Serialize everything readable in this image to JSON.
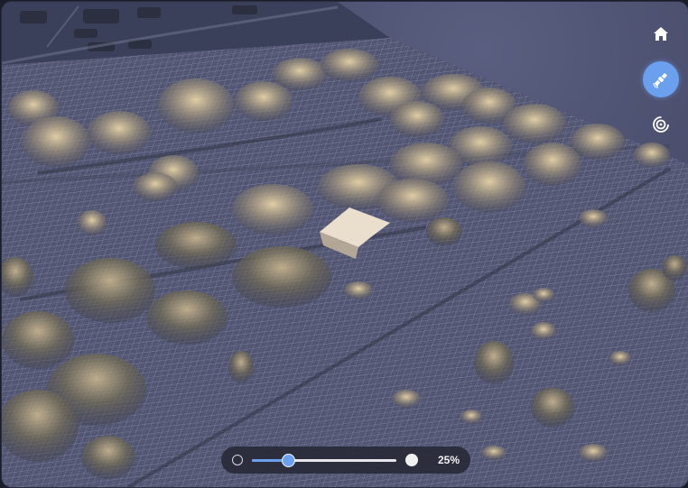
{
  "controls": {
    "home_icon": "home-icon",
    "satellite_icon": "satellite-icon",
    "radar_icon": "radar-icon",
    "active_color": "#6aa0ee"
  },
  "opacity_slider": {
    "value": 0.25,
    "label": "25%",
    "accent": "#6aa0ee"
  }
}
